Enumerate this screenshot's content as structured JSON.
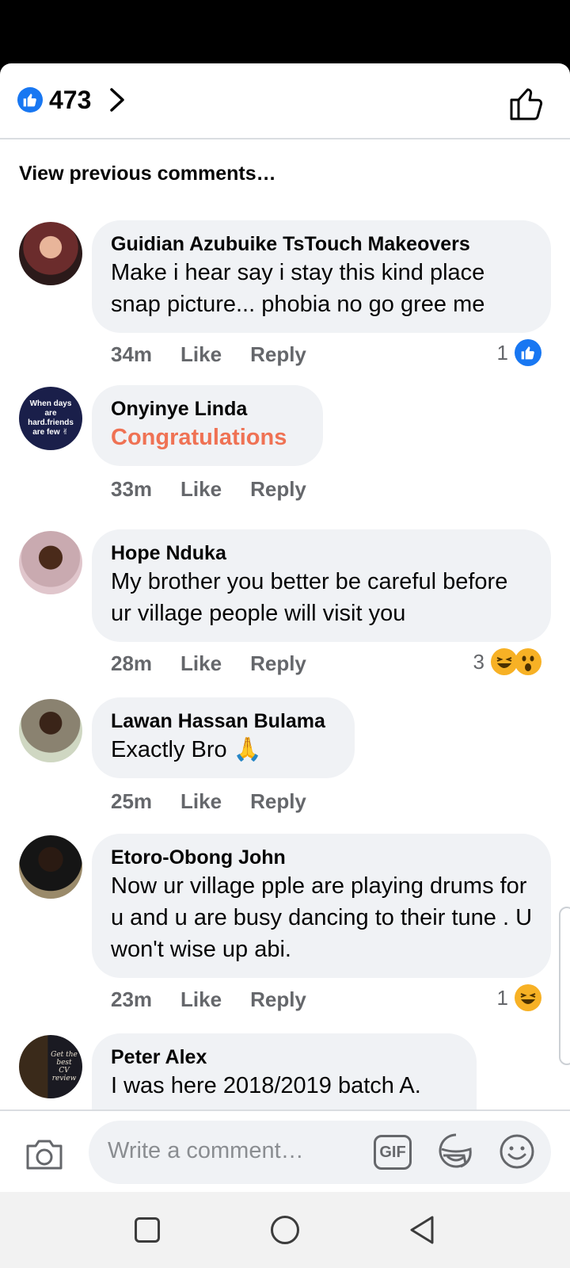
{
  "reactions": {
    "count": "473"
  },
  "view_previous": "View previous comments…",
  "comments": [
    {
      "author": "Guidian Azubuike TsTouch Makeovers",
      "text": "Make i hear say i stay this kind place snap picture... phobia no go gree me",
      "time": "34m",
      "like": "Like",
      "reply": "Reply",
      "reaction_count": "1",
      "reaction_icons": [
        "like-icon"
      ]
    },
    {
      "author": "Onyinye Linda",
      "text": "Congratulations",
      "time": "33m",
      "like": "Like",
      "reply": "Reply",
      "avatar_text": "When days are hard.friends are few ✌"
    },
    {
      "author": "Hope Nduka",
      "text": "My brother you better be careful before ur village people will visit you",
      "time": "28m",
      "like": "Like",
      "reply": "Reply",
      "reaction_count": "3",
      "reaction_icons": [
        "haha-icon",
        "wow-icon"
      ]
    },
    {
      "author": "Lawan Hassan Bulama",
      "text": "Exactly Bro 🙏",
      "time": "25m",
      "like": "Like",
      "reply": "Reply"
    },
    {
      "author": "Etoro-Obong John",
      "text": "Now ur village pple are playing drums for u and u are busy dancing to their tune . U won't wise up abi.",
      "time": "23m",
      "like": "Like",
      "reply": "Reply",
      "reaction_count": "1",
      "reaction_icons": [
        "haha-icon"
      ]
    },
    {
      "author": "Peter Alex",
      "text": "I was here 2018/2019 batch A.",
      "avatar_text": "Get the best CV review"
    }
  ],
  "composer": {
    "placeholder": "Write a comment…",
    "gif_label": "GIF"
  },
  "colors": {
    "accent": "#1877f2",
    "bubble": "#f0f2f5",
    "meta": "#65676b",
    "highlight": "#ef7254"
  }
}
